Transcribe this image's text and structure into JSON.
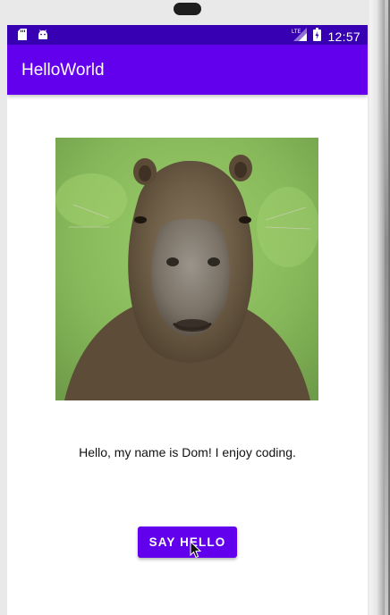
{
  "status_bar": {
    "time": "12:57",
    "left_icons": [
      "sd-card-icon",
      "android-icon"
    ],
    "right_icons": [
      "lte-signal-icon",
      "battery-icon"
    ],
    "color": "#3700b3"
  },
  "app_bar": {
    "title": "HelloWorld",
    "color": "#6200ee"
  },
  "content": {
    "image_subject": "capybara",
    "greeting": "Hello, my name is Dom! I enjoy coding.",
    "button_label": "SAY HELLO"
  },
  "colors": {
    "primary": "#6200ee",
    "primary_dark": "#3700b3"
  }
}
